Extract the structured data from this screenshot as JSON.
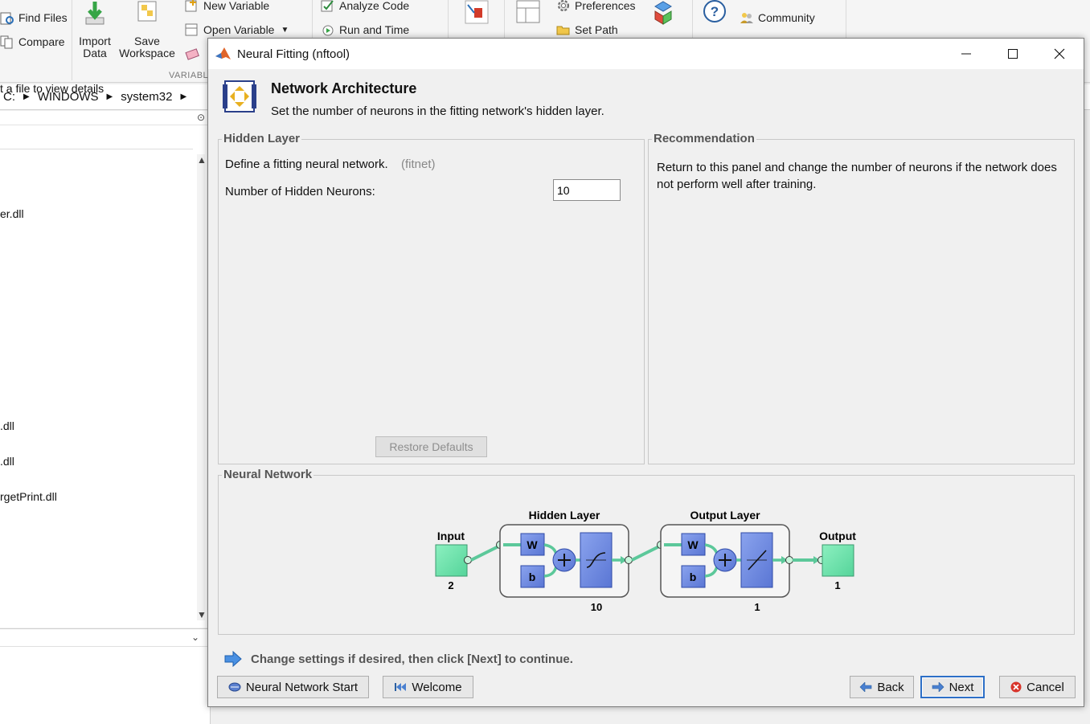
{
  "toolstrip": {
    "find_files": "Find Files",
    "compare": "Compare",
    "import_data_line1": "Import",
    "import_data_line2": "Data",
    "save_workspace_line1": "Save",
    "save_workspace_line2": "Workspace",
    "new_variable": "New Variable",
    "open_variable": "Open Variable",
    "group_label": "VARIABL",
    "analyze_code": "Analyze Code",
    "run_and_time": "Run and Time",
    "preferences": "Preferences",
    "set_path": "Set Path",
    "community": "Community"
  },
  "address": {
    "crumbs": [
      "C:",
      "WINDOWS",
      "system32"
    ]
  },
  "files": {
    "items": [
      "er.dll",
      ".dll",
      ".dll",
      "rgetPrint.dll"
    ]
  },
  "details": {
    "text": "t a file to view details"
  },
  "dialog": {
    "title": "Neural Fitting (nftool)",
    "page_title": "Network Architecture",
    "page_subtitle": "Set the number of neurons in the fitting network's hidden layer.",
    "hidden_layer": {
      "legend": "Hidden Layer",
      "define_text": "Define a fitting neural network.",
      "fitnet": "(fitnet)",
      "neurons_label": "Number of Hidden Neurons:",
      "neurons_value": "10",
      "restore_defaults": "Restore Defaults"
    },
    "recommendation": {
      "legend": "Recommendation",
      "text": "Return to this panel and change the number of neurons if the network does not perform well after training."
    },
    "neural_network": {
      "legend": "Neural Network",
      "input_label": "Input",
      "input_size": "2",
      "hidden_label": "Hidden Layer",
      "hidden_size": "10",
      "output_layer_label": "Output Layer",
      "output_layer_size": "1",
      "output_label": "Output",
      "output_size": "1",
      "w": "W",
      "b": "b"
    },
    "info_text": "Change settings  if desired, then click [Next] to continue.",
    "buttons": {
      "nn_start": "Neural Network Start",
      "welcome": "Welcome",
      "back": "Back",
      "next": "Next",
      "cancel": "Cancel"
    }
  },
  "colors": {
    "dialog_bg": "#f0f0f0",
    "block_blue": "#6b88e0",
    "block_green": "#6fe3ad",
    "link_green": "#5cc89a",
    "focus_blue": "#2d6fc7"
  }
}
